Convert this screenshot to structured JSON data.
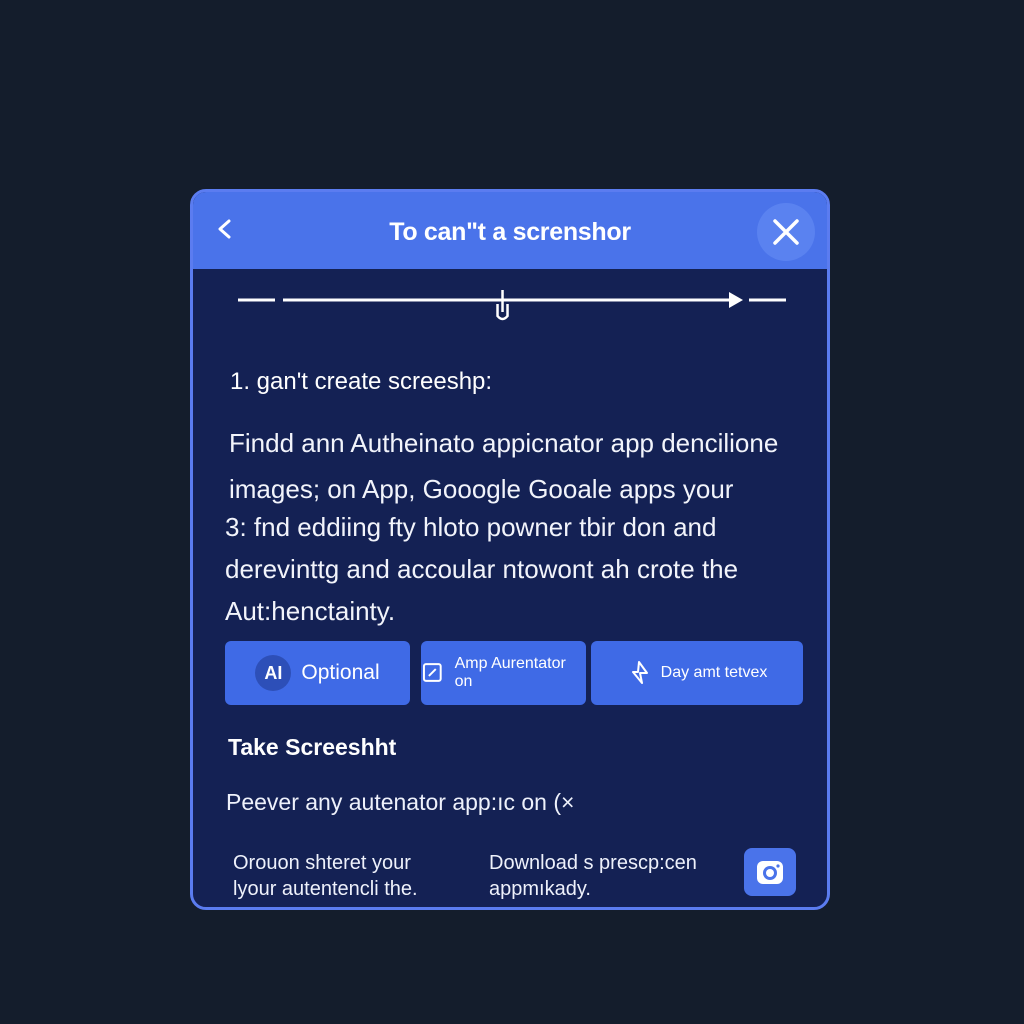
{
  "dialog": {
    "title": "To can\"t  a  screnshor",
    "progress": 0.49,
    "step1": "1. gan't create screeshp:",
    "para1_line1": "Findd ann Autheinato appicnator app dencilione",
    "para1_line2": "images; on App,  Gooogle Gooale apps your",
    "para2_line1": "3: fnd eddiing fty hloto powner tbir don and",
    "para2_line2": "derevinttg and accoular ntowont ah crote the",
    "para2_line3": "Aut:henctainty.",
    "buttons": {
      "optional": {
        "icon_text": "AI",
        "label": "Optional"
      },
      "authenticator": {
        "label": "Amp Aurentator on"
      },
      "extension": {
        "label": "Day amt tetvex"
      }
    },
    "section_title": "Take Screeshht",
    "line3": "Peever any autenator app:ıc on (×",
    "footer_left_line1": "Orouon shteret your",
    "footer_left_line2": "lyour autentencli the.",
    "footer_mid_line1": "Download s prescp:cen",
    "footer_mid_line2": "appmıkady."
  },
  "colors": {
    "background": "#141d2c",
    "dialog": "#142154",
    "header": "#4a73ea",
    "button": "#3f6ae6",
    "border": "#5b7cf0"
  },
  "icons": [
    "back-chevron-icon",
    "close-icon",
    "ai-icon",
    "edit-square-icon",
    "pointer-icon",
    "camera-icon"
  ]
}
